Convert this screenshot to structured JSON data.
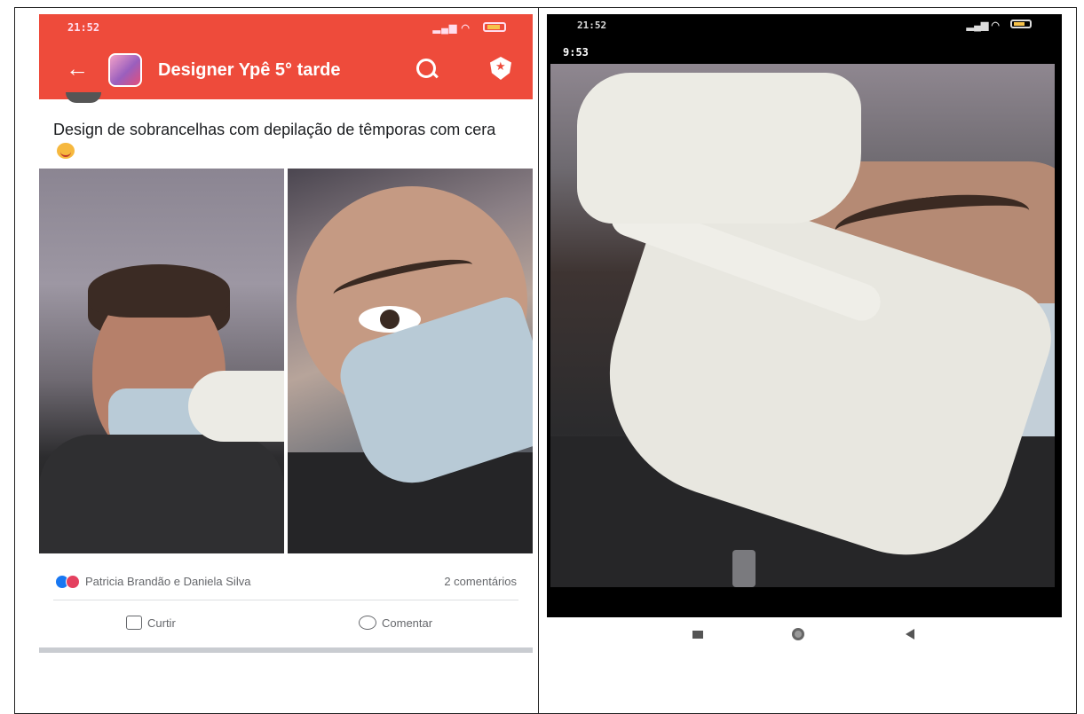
{
  "left_phone": {
    "status_time": "21:52",
    "group_title": "Designer  Ypê 5° tarde",
    "post_text": "Design de sobrancelhas com depilação de têmporas com cera",
    "reactions_names": "Patricia Brandão e Daniela Silva",
    "comments_count": "2 comentários",
    "like_label": "Curtir",
    "comment_label": "Comentar",
    "header_color": "#ee4b3b"
  },
  "right_phone": {
    "status_time": "21:52",
    "video_timer": "9:53"
  }
}
